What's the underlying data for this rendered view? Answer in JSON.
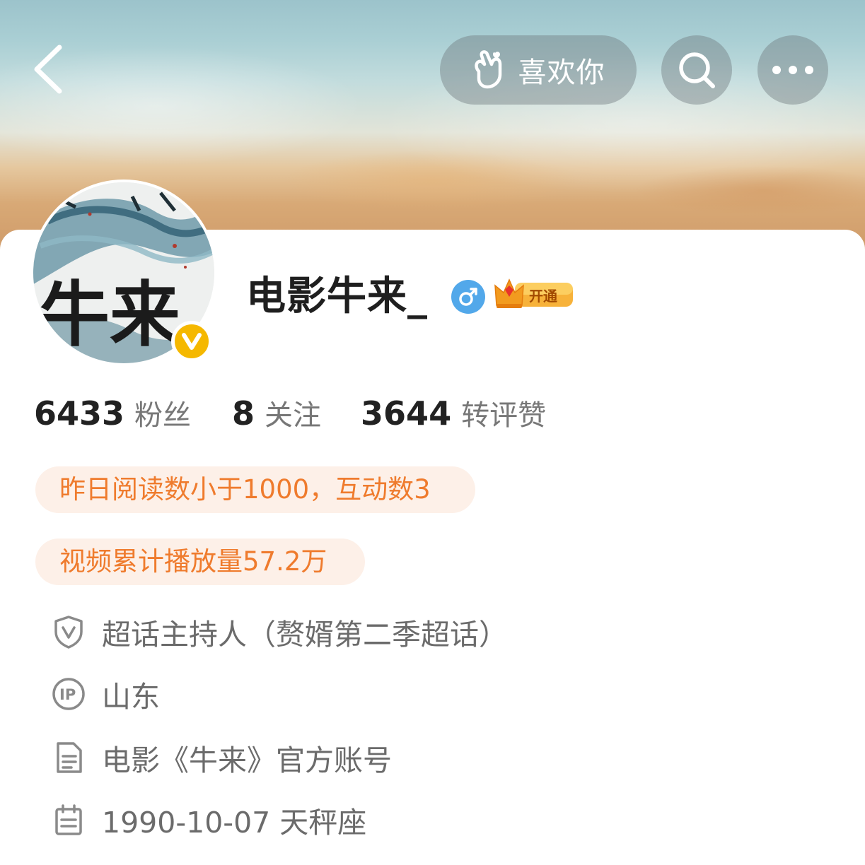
{
  "header": {
    "like_button_label": "喜欢你"
  },
  "profile": {
    "username": "电影牛来_",
    "avatar_text": "牛来",
    "vip_badge_label": "开通",
    "verified_mark": "V",
    "gender": "male"
  },
  "stats": [
    {
      "value": "6433",
      "label": "粉丝"
    },
    {
      "value": "8",
      "label": "关注"
    },
    {
      "value": "3644",
      "label": "转评赞"
    }
  ],
  "tags": [
    {
      "text": "昨日阅读数小于1000，互动数3"
    },
    {
      "text": "视频累计播放量57.2万"
    }
  ],
  "info": [
    {
      "icon": "shield-v-icon",
      "text": "超话主持人（赘婿第二季超话）"
    },
    {
      "icon": "ip-location-icon",
      "text": "山东"
    },
    {
      "icon": "document-icon",
      "text": "电影《牛来》官方账号"
    },
    {
      "icon": "calendar-icon",
      "text": "1990-10-07 天秤座"
    }
  ],
  "colors": {
    "accent_orange": "#ef7b2d",
    "tag_background": "#fdf0e8",
    "verified_gold": "#f5b800",
    "gender_blue": "#52a8ea"
  }
}
